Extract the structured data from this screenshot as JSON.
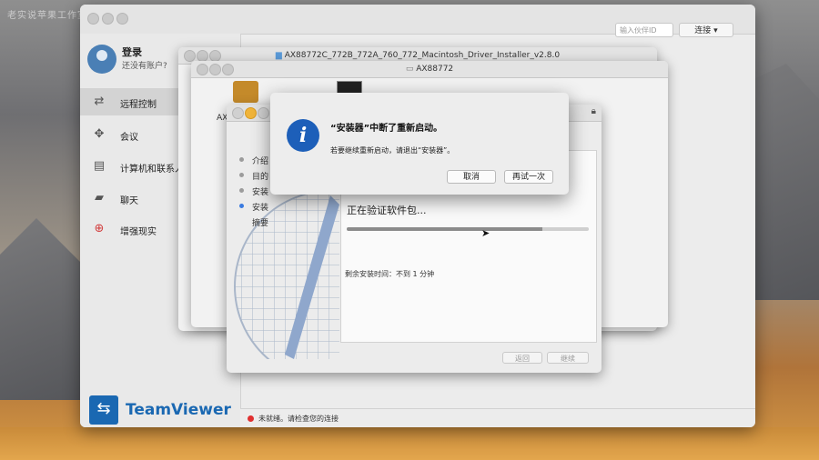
{
  "watermark": "老实说苹果工作室",
  "teamviewer": {
    "login": "登录",
    "no_account": "还没有账户?",
    "nav": [
      {
        "label": "远程控制",
        "icon": "remote-control-icon"
      },
      {
        "label": "会议",
        "icon": "meeting-icon"
      },
      {
        "label": "计算机和联系人",
        "icon": "contacts-icon"
      },
      {
        "label": "聊天",
        "icon": "chat-icon"
      },
      {
        "label": "增强现实",
        "icon": "augmented-reality-icon"
      }
    ],
    "search_placeholder": "输入伙伴ID",
    "connect_label": "连接",
    "logo": "TeamViewer",
    "status": "未就绪。请检查您的连接"
  },
  "finder_window": {
    "title": "AX88772C_772B_772A_760_772_Macintosh_Driver_Installer_v2.8.0"
  },
  "package_window": {
    "title": "AX88772",
    "label_fragment": "AX"
  },
  "installer": {
    "steps": [
      "介绍",
      "目的",
      "安装",
      "安装",
      "摘要"
    ],
    "current_step_index": 3,
    "progress_title": "正在验证软件包...",
    "progress": 0.81,
    "time_remaining": "剩余安装时间：不到 1 分钟",
    "back_label": "返回",
    "continue_label": "继续"
  },
  "dialog": {
    "title": "“安装器”中断了重新启动。",
    "message": "若要继续重新启动，请退出“安装器”。",
    "cancel_label": "取消",
    "retry_label": "再试一次"
  },
  "colors": {
    "accent": "#1d5fb9",
    "teamviewer_blue": "#1a68b2",
    "status_red": "#e03030"
  }
}
